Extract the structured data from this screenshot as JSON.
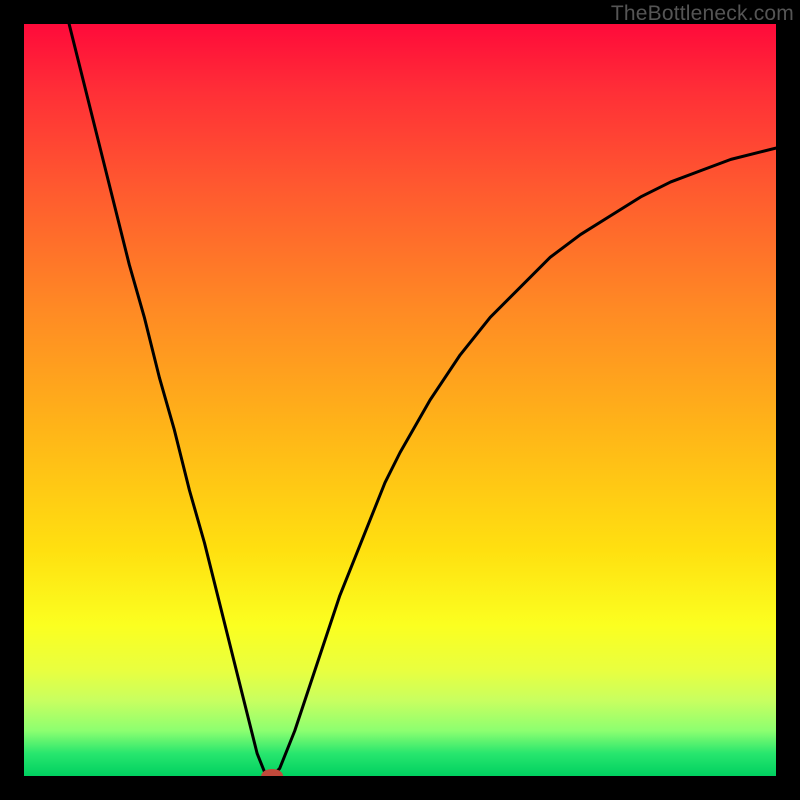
{
  "watermark": "TheBottleneck.com",
  "chart_data": {
    "type": "line",
    "title": "",
    "xlabel": "",
    "ylabel": "",
    "xlim": [
      0,
      100
    ],
    "ylim": [
      0,
      100
    ],
    "grid": false,
    "series": [
      {
        "name": "curve",
        "x": [
          6,
          8,
          10,
          12,
          14,
          16,
          18,
          20,
          22,
          24,
          26,
          28,
          30,
          31,
          32,
          33,
          34,
          36,
          38,
          40,
          42,
          44,
          46,
          48,
          50,
          54,
          58,
          62,
          66,
          70,
          74,
          78,
          82,
          86,
          90,
          94,
          98,
          100
        ],
        "y": [
          100,
          92,
          84,
          76,
          68,
          61,
          53,
          46,
          38,
          31,
          23,
          15,
          7,
          3,
          0.5,
          0,
          1,
          6,
          12,
          18,
          24,
          29,
          34,
          39,
          43,
          50,
          56,
          61,
          65,
          69,
          72,
          74.5,
          77,
          79,
          80.5,
          82,
          83,
          83.5
        ]
      }
    ],
    "marker": {
      "x": 33,
      "y": 0,
      "color": "#c1493b"
    },
    "background": "rainbow-vertical"
  },
  "colors": {
    "curve": "#000000",
    "marker": "#c1493b",
    "frame": "#000000"
  }
}
